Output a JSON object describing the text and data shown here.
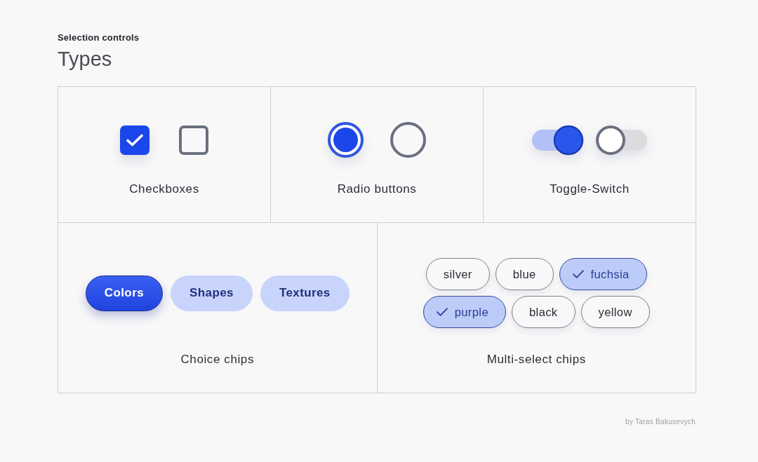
{
  "header": {
    "eyebrow": "Selection controls",
    "title": "Types"
  },
  "rows": [
    {
      "cells": [
        {
          "kind": "checkboxes",
          "label": "Checkboxes",
          "items": [
            {
              "checked": true
            },
            {
              "checked": false
            }
          ]
        },
        {
          "kind": "radios",
          "label": "Radio buttons",
          "items": [
            {
              "selected": true
            },
            {
              "selected": false
            }
          ]
        },
        {
          "kind": "toggles",
          "label": "Toggle-Switch",
          "items": [
            {
              "on": true
            },
            {
              "on": false
            }
          ]
        }
      ]
    },
    {
      "cells": [
        {
          "kind": "choice_chips",
          "label": "Choice chips",
          "chips": [
            {
              "label": "Colors",
              "selected": true
            },
            {
              "label": "Shapes",
              "selected": false
            },
            {
              "label": "Textures",
              "selected": false
            }
          ]
        },
        {
          "kind": "multi_chips",
          "label": "Multi-select chips",
          "rows": [
            {
              "chips": [
                {
                  "label": "silver",
                  "selected": false
                },
                {
                  "label": "blue",
                  "selected": false
                },
                {
                  "label": "fuchsia",
                  "selected": true
                }
              ]
            },
            {
              "chips": [
                {
                  "label": "purple",
                  "selected": true
                },
                {
                  "label": "black",
                  "selected": false
                },
                {
                  "label": "yellow",
                  "selected": false
                }
              ]
            }
          ]
        }
      ]
    }
  ],
  "credit": "by Taras Bakusevych"
}
